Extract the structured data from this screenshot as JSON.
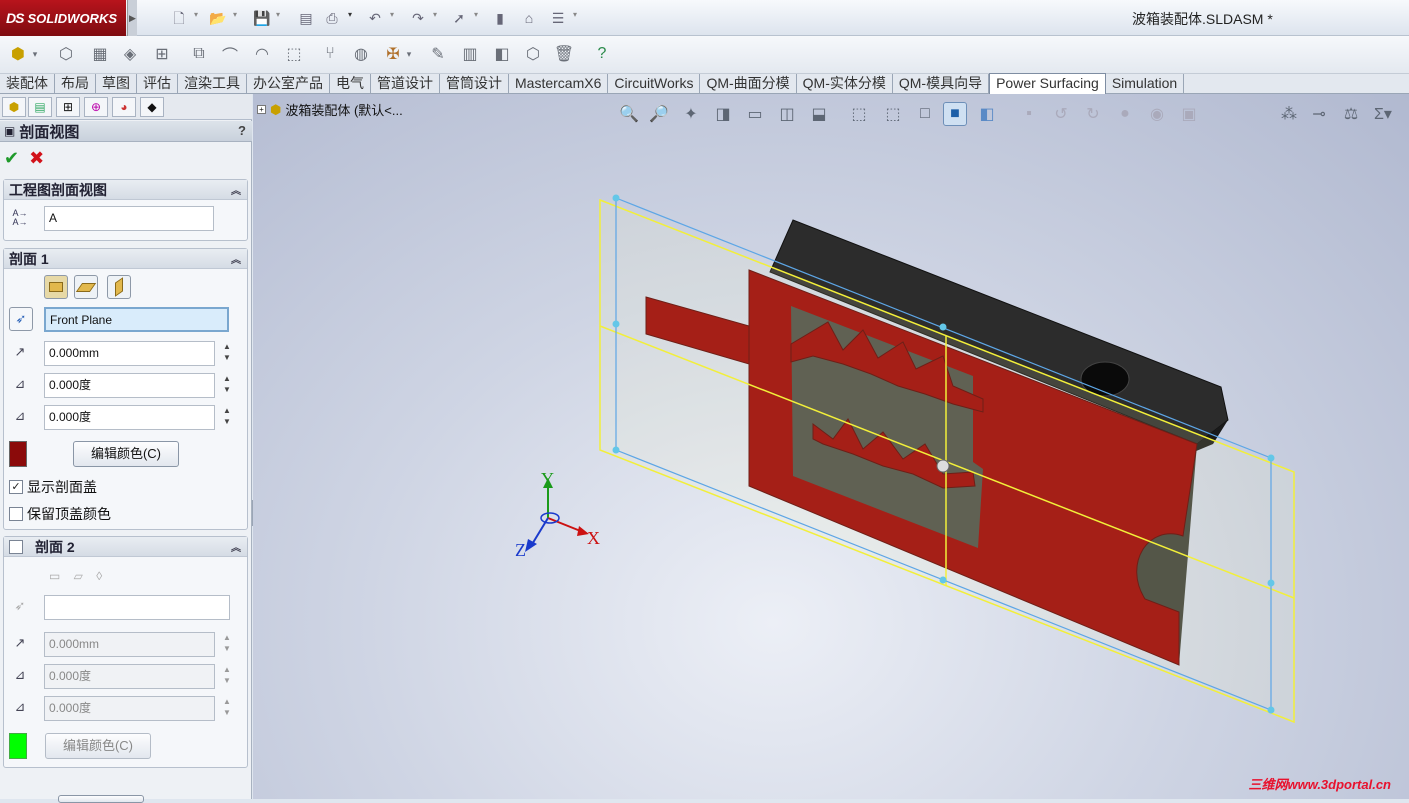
{
  "app": {
    "brand": "SOLIDWORKS",
    "brand_prefix": "DS",
    "document_title": "波箱装配体.SLDASM *"
  },
  "tabs": [
    {
      "label": "装配体",
      "active": false
    },
    {
      "label": "布局",
      "active": false
    },
    {
      "label": "草图",
      "active": false
    },
    {
      "label": "评估",
      "active": false
    },
    {
      "label": "渲染工具",
      "active": false
    },
    {
      "label": "办公室产品",
      "active": false
    },
    {
      "label": "电气",
      "active": false
    },
    {
      "label": "管道设计",
      "active": false
    },
    {
      "label": "管筒设计",
      "active": false
    },
    {
      "label": "MastercamX6",
      "active": false
    },
    {
      "label": "CircuitWorks",
      "active": false
    },
    {
      "label": "QM-曲面分模",
      "active": false
    },
    {
      "label": "QM-实体分模",
      "active": false
    },
    {
      "label": "QM-模具向导",
      "active": false
    },
    {
      "label": "Power Surfacing",
      "active": true
    },
    {
      "label": "Simulation",
      "active": false
    }
  ],
  "property_manager": {
    "title": "剖面视图",
    "help": "?",
    "ok_symbol": "✔",
    "cancel_symbol": "✖",
    "drawing_section": {
      "title": "工程图剖面视图",
      "label_value": "A"
    },
    "section1": {
      "title": "剖面 1",
      "plane": "Front Plane",
      "offset": "0.000mm",
      "angle_x": "0.000度",
      "angle_y": "0.000度",
      "edit_color": "编辑颜色(C)",
      "color": "#8b0a0a",
      "show_cap": {
        "label": "显示剖面盖",
        "checked": true
      },
      "keep_cap_color": {
        "label": "保留顶盖颜色",
        "checked": false
      }
    },
    "section2": {
      "title": "剖面 2",
      "enabled": false,
      "plane": "",
      "offset": "0.000mm",
      "angle_x": "0.000度",
      "angle_y": "0.000度",
      "edit_color": "编辑颜色(C)",
      "color": "#00ff00"
    }
  },
  "viewport": {
    "tree_root": "波箱装配体  (默认<...",
    "triad": {
      "x": "X",
      "y": "Y",
      "z": "Z"
    },
    "watermark": "三维网www.3dportal.cn"
  }
}
